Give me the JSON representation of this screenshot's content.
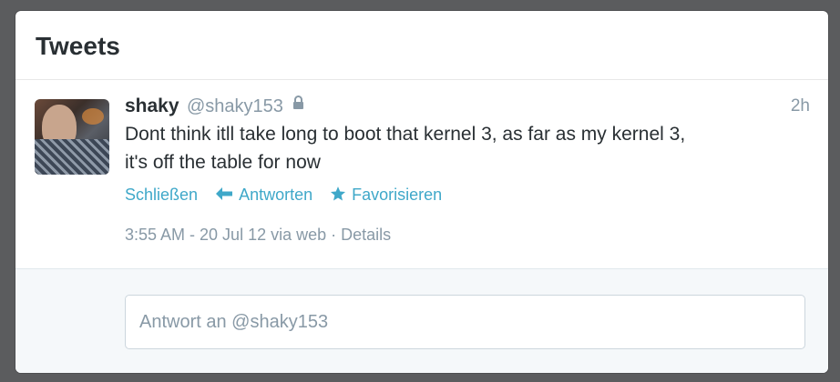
{
  "header": {
    "title": "Tweets"
  },
  "tweet": {
    "fullname": "shaky",
    "username": "@shaky153",
    "time": "2h",
    "text_line1": "Dont think itll take long to boot that kernel 3, as far as my kernel 3,",
    "text_line2": "it's off the table for now",
    "actions": {
      "close": "Schließen",
      "reply": "Antworten",
      "favorite": "Favorisieren"
    },
    "meta": {
      "timestamp": "3:55 AM - 20 Jul 12",
      "via": "via web",
      "separator": "·",
      "details": "Details"
    }
  },
  "reply": {
    "placeholder": "Antwort an @shaky153"
  },
  "colors": {
    "accent": "#3fa8c9",
    "muted": "#8899a6",
    "text": "#292f33",
    "background": "#5b5c5e"
  },
  "icons": [
    "lock-icon",
    "reply-arrow-icon",
    "star-icon"
  ]
}
